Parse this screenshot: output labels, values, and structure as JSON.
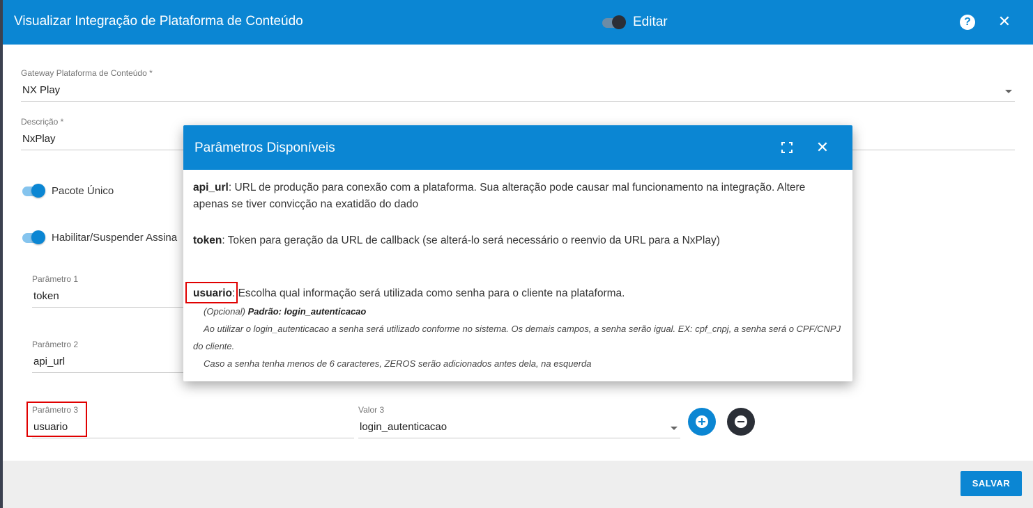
{
  "header": {
    "title": "Visualizar Integração de Plataforma de Conteúdo",
    "edit_label": "Editar",
    "help_glyph": "?",
    "close_glyph": "✕"
  },
  "form": {
    "gateway": {
      "label": "Gateway Plataforma de Conteúdo *",
      "value": "NX Play"
    },
    "descricao": {
      "label": "Descrição *",
      "value": "NxPlay"
    },
    "pacote_unico": {
      "label": "Pacote Único",
      "enabled": true
    },
    "habilitar": {
      "label": "Habilitar/Suspender Assina",
      "enabled": true
    },
    "parametros": [
      {
        "label": "Parâmetro 1",
        "value": "token"
      },
      {
        "label": "Parâmetro 2",
        "value": "api_url"
      },
      {
        "label": "Parâmetro 3",
        "value": "usuario"
      }
    ],
    "valor3": {
      "label": "Valor 3",
      "value": "login_autenticacao"
    }
  },
  "footer": {
    "save_label": "SALVAR"
  },
  "popup": {
    "title": "Parâmetros Disponíveis",
    "close_glyph": "✕",
    "api_url": {
      "key": "api_url",
      "desc": ": URL de produção para conexão com a plataforma. Sua alteração pode causar mal funcionamento na integração. Altere apenas se tiver convicção na exatidão do dado"
    },
    "token": {
      "key": "token",
      "desc": ": Token para geração da URL de callback (se alterá-lo será necessário o reenvio da URL para a NxPlay)"
    },
    "usuario": {
      "key": "usuario",
      "desc": ": Escolha qual informação será utilizada como senha para o cliente na plataforma.",
      "optional": "(Opcional)",
      "default": "Padrão: login_autenticacao",
      "note1": "Ao utilizar o login_autenticacao a senha será utilizado conforme no sistema. Os demais campos, a senha serão igual. EX: cpf_cnpj, a senha será o CPF/CNPJ do cliente.",
      "note2": "Caso a senha tenha menos de 6 caracteres, ZEROS serão adicionados antes dela, na esquerda"
    }
  },
  "colors": {
    "primary": "#0b86d3",
    "dark_button": "#2b2f37",
    "highlight": "#e00000"
  }
}
